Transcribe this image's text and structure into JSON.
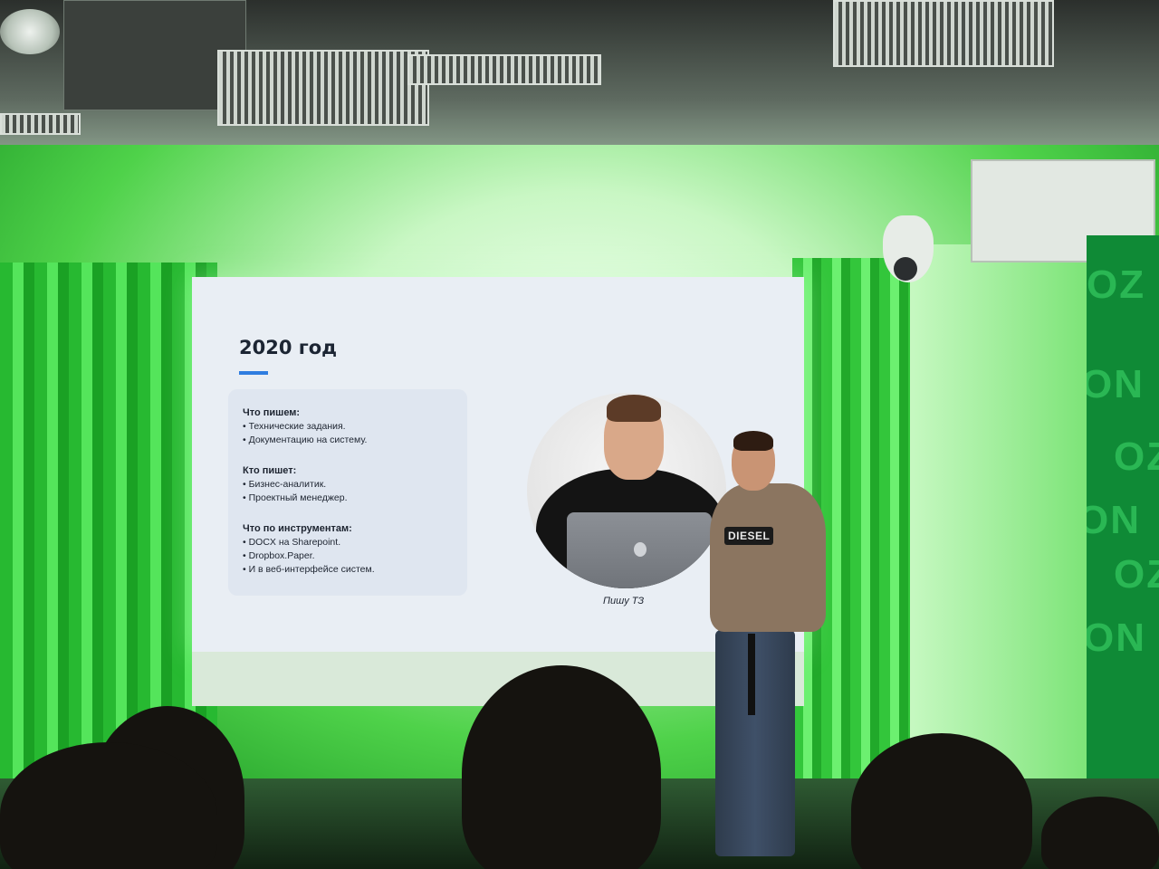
{
  "slide": {
    "title": "2020 год",
    "sections": [
      {
        "heading": "Что пишем:",
        "items": [
          "Технические задания.",
          "Документацию на систему."
        ]
      },
      {
        "heading": "Кто пишет:",
        "items": [
          "Бизнес-аналитик.",
          "Проектный менеджер."
        ]
      },
      {
        "heading": "Что по инструментам:",
        "items": [
          "DOCX на Sharepoint.",
          "Dropbox.Paper.",
          "И в веб-интерфейсе систем."
        ]
      }
    ],
    "photo_caption": "Пишу ТЗ"
  },
  "venue": {
    "brand_wall_text": [
      "OZ",
      "ON",
      "OZ",
      "ON",
      "OZ",
      "ON"
    ],
    "speaker_sweater_logo": "DIESEL"
  },
  "colors": {
    "ambient_green": "#3fd447",
    "slide_accent": "#2f7de0",
    "brand_green": "#0f8a36"
  }
}
